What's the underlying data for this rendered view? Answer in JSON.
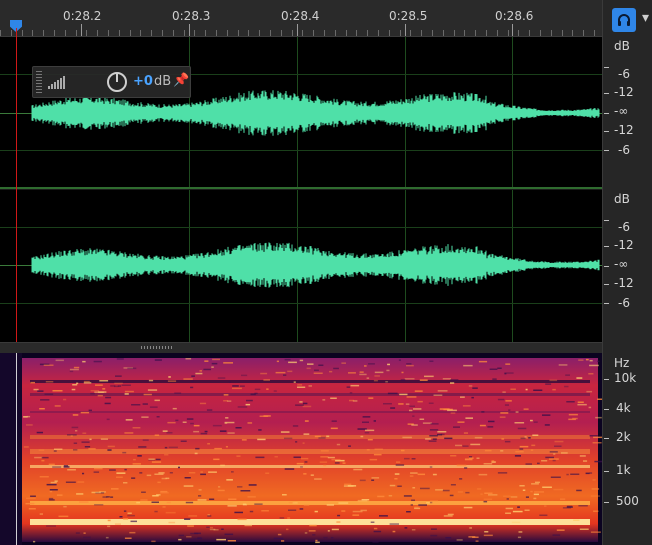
{
  "ruler": {
    "ticks": [
      "0:28.2",
      "0:28.3",
      "0:28.4",
      "0:28.5",
      "0:28.6"
    ]
  },
  "hud": {
    "gain_value": "+0",
    "gain_unit": "dB"
  },
  "db_scale": {
    "unit": "dB",
    "labels": [
      "-6",
      "-12",
      "-∞",
      "-12",
      "-6"
    ]
  },
  "hz_scale": {
    "unit": "Hz",
    "labels": [
      "10k",
      "4k",
      "2k",
      "1k",
      "500"
    ]
  },
  "icons": {
    "headphones": "headphones-icon",
    "pin": "pin-icon",
    "level": "level-meter-icon",
    "knob": "gain-knob-icon"
  },
  "colors": {
    "waveform": "#4fe0a8",
    "playhead": "#d01818",
    "accent": "#2f86e8",
    "grid": "#1e4b1e"
  }
}
